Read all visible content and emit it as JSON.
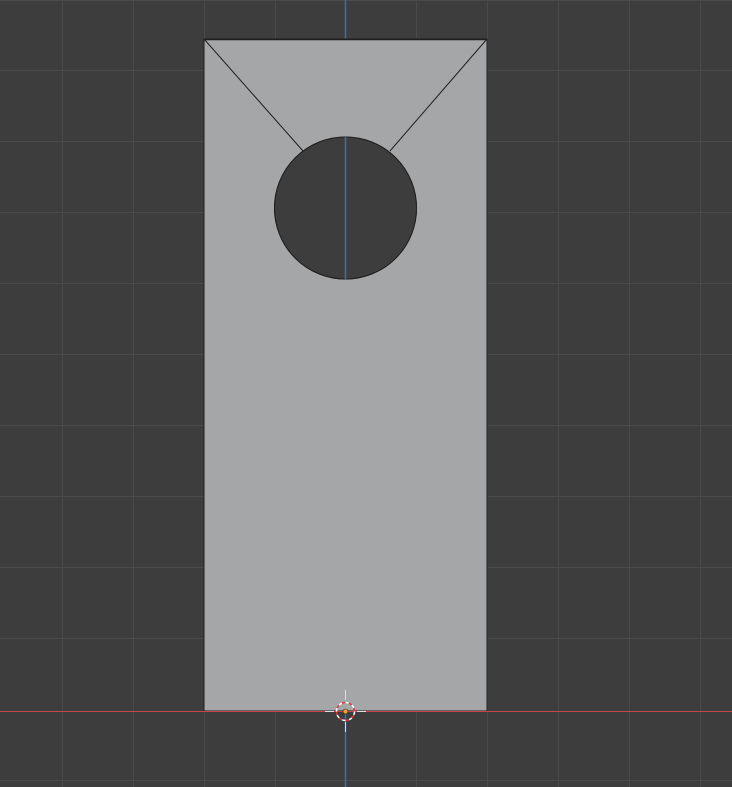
{
  "viewport": {
    "view": "front-orthographic",
    "background_color": "#3d3d3d",
    "grid_color": "#4a4a4a",
    "x_axis_color": "#c4454a",
    "z_axis_color": "#3d6fb0",
    "mesh_face_color": "#a5a6a8",
    "mesh_edge_color": "#1f1f1f",
    "hole_color": "#3d3d3d",
    "cursor_icon": "3d-cursor-icon",
    "origin_icon": "object-origin-icon"
  }
}
